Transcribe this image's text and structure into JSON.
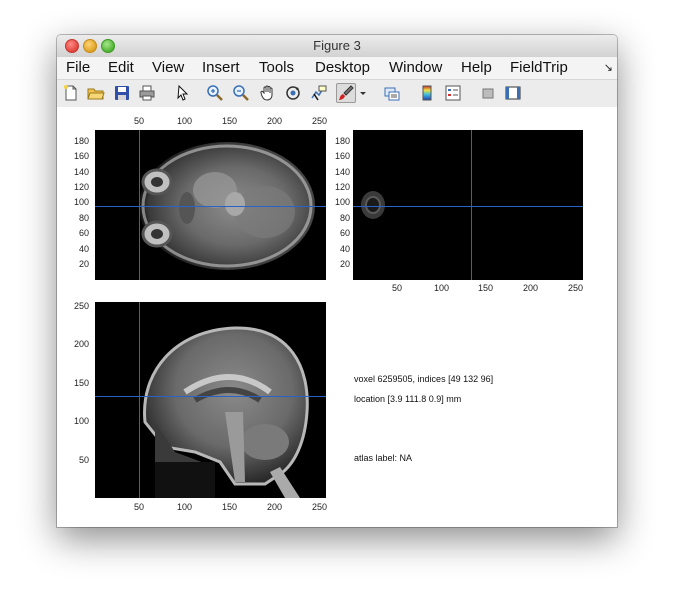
{
  "window": {
    "title": "Figure 3"
  },
  "menu": {
    "items": [
      "File",
      "Edit",
      "View",
      "Insert",
      "Tools",
      "Desktop",
      "Window",
      "Help",
      "FieldTrip"
    ],
    "overflow_icon": "chevron-more-icon"
  },
  "toolbar": {
    "buttons": [
      "new-figure-icon",
      "open-file-icon",
      "save-icon",
      "print-icon",
      "edit-plot-icon",
      "zoom-in-icon",
      "zoom-out-icon",
      "pan-icon",
      "rotate-3d-icon",
      "data-cursor-icon",
      "brush-icon",
      "brush-menu-icon",
      "link-icon",
      "colorbar-icon",
      "legend-icon",
      "hide-plot-tools-icon",
      "show-plot-tools-icon"
    ]
  },
  "axes": {
    "axial": {
      "x_ticks": [
        "50",
        "100",
        "150",
        "200",
        "250"
      ],
      "y_ticks": [
        "180",
        "160",
        "140",
        "120",
        "100",
        "80",
        "60",
        "40",
        "20"
      ]
    },
    "coronal": {
      "x_ticks": [
        "50",
        "100",
        "150",
        "200",
        "250"
      ],
      "y_ticks": [
        "180",
        "160",
        "140",
        "120",
        "100",
        "80",
        "60",
        "40",
        "20"
      ]
    },
    "sagittal": {
      "x_ticks": [
        "50",
        "100",
        "150",
        "200",
        "250"
      ],
      "y_ticks": [
        "250",
        "200",
        "150",
        "100",
        "50"
      ]
    }
  },
  "info": {
    "voxel": "voxel 6259505, indices [49 132 96]",
    "location": "location [3.9 111.8 0.9] mm",
    "atlas": "atlas label: NA"
  },
  "colors": {
    "crosshair": "#2a63c8",
    "panel_bg": "#000000"
  }
}
